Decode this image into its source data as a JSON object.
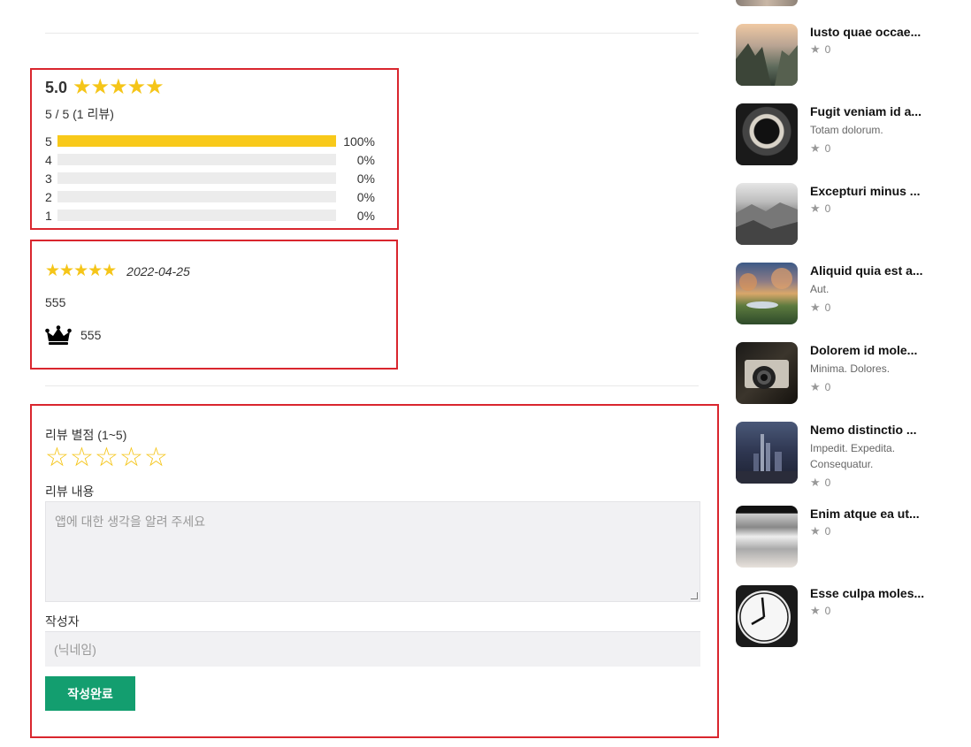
{
  "summary": {
    "average": "5.0",
    "average_stars": "★★★★★",
    "text": "5 / 5 (1 리뷰)",
    "distribution": [
      {
        "label": "5",
        "percent": 100,
        "percent_text": "100%"
      },
      {
        "label": "4",
        "percent": 0,
        "percent_text": "0%"
      },
      {
        "label": "3",
        "percent": 0,
        "percent_text": "0%"
      },
      {
        "label": "2",
        "percent": 0,
        "percent_text": "0%"
      },
      {
        "label": "1",
        "percent": 0,
        "percent_text": "0%"
      }
    ]
  },
  "review": {
    "stars": "★★★★★",
    "date": "2022-04-25",
    "body": "555",
    "author": "555"
  },
  "form": {
    "rating_label": "리뷰 별점 (1~5)",
    "rating_stars": [
      "☆",
      "☆",
      "☆",
      "☆",
      "☆"
    ],
    "content_label": "리뷰 내용",
    "content_placeholder": "앱에 대한 생각을 알려 주세요",
    "author_label": "작성자",
    "author_placeholder": "(닉네임)",
    "submit_label": "작성완료"
  },
  "sidebar": {
    "items": [
      {
        "title": "Iusto quae occae...",
        "desc": "",
        "rating": "0"
      },
      {
        "title": "Fugit veniam id a...",
        "desc": "Totam dolorum.",
        "rating": "0"
      },
      {
        "title": "Excepturi minus ...",
        "desc": "",
        "rating": "0"
      },
      {
        "title": "Aliquid quia est a...",
        "desc": "Aut.",
        "rating": "0"
      },
      {
        "title": "Dolorem id mole...",
        "desc": "Minima. Dolores.",
        "rating": "0"
      },
      {
        "title": "Nemo distinctio ...",
        "desc": "Impedit. Expedita. Consequatur.",
        "rating": "0"
      },
      {
        "title": "Enim atque ea ut...",
        "desc": "",
        "rating": "0"
      },
      {
        "title": "Esse culpa moles...",
        "desc": "",
        "rating": "0"
      }
    ]
  },
  "colors": {
    "accent_star": "#f5c518",
    "bar_fill": "#f8c91a",
    "submit": "#139e6f",
    "highlight_border": "#d9262e"
  }
}
